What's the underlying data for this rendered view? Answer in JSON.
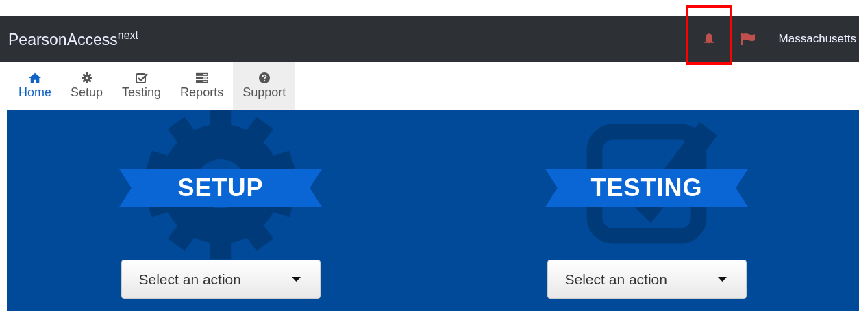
{
  "header": {
    "brand": "PearsonAccess",
    "brand_sup": "next",
    "bell_highlighted": true,
    "user": "Massachusetts"
  },
  "nav": [
    {
      "label": "Home",
      "kind": "home",
      "selected": true,
      "hovered": false
    },
    {
      "label": "Setup",
      "kind": "gear",
      "selected": false,
      "hovered": false
    },
    {
      "label": "Testing",
      "kind": "check",
      "selected": false,
      "hovered": false
    },
    {
      "label": "Reports",
      "kind": "reports",
      "selected": false,
      "hovered": false
    },
    {
      "label": "Support",
      "kind": "question",
      "selected": false,
      "hovered": true
    }
  ],
  "panels": [
    {
      "kind": "gear",
      "title": "SETUP",
      "dropdown": "Select an action"
    },
    {
      "kind": "check",
      "title": "TESTING",
      "dropdown": "Select an action"
    }
  ]
}
